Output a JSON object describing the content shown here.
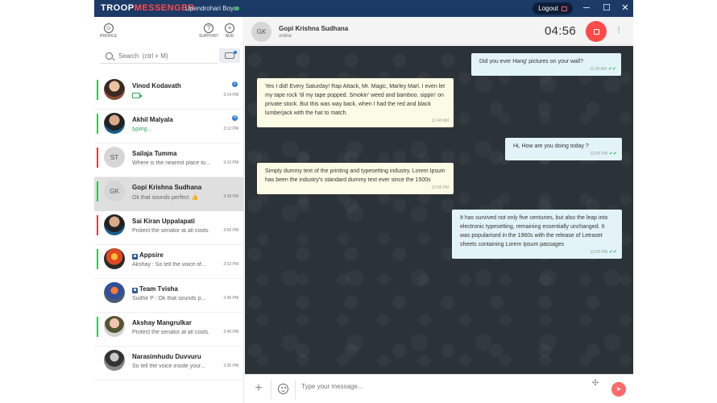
{
  "titlebar": {
    "brand_part1": "TROOP",
    "brand_part2": "MESSENGER",
    "username": "Upendrohari Boyo",
    "logout_label": "Logout",
    "minimize": "─",
    "maximize": "☐",
    "close": "✕"
  },
  "toolbar": {
    "profile_label": "PROFILE",
    "support_label": "SUPPORT",
    "add_label": "ADD"
  },
  "search": {
    "placeholder": "Search  (ctrl + M)"
  },
  "contacts": [
    {
      "name": "Vinod Kodavath",
      "message": "",
      "time": "3:14 PM",
      "badge": "2",
      "bar": "#33c14f",
      "avatar": "photo",
      "initials": ""
    },
    {
      "name": "Akhil Malyala",
      "message": "typing...",
      "time": "3:12 PM",
      "badge": "4",
      "bar": "#33c14f",
      "avatar": "photo2",
      "initials": ""
    },
    {
      "name": "Sailaja Tumma",
      "message": "Where is the nearest place to...",
      "time": "3:10 PM",
      "badge": "",
      "bar": "#e43b3b",
      "avatar": "init",
      "initials": "ST"
    },
    {
      "name": "Gopi Krishna Sudhana",
      "message": "Ok that sounds perfect",
      "time": "3:39 PM",
      "badge": "",
      "bar": "#33c14f",
      "avatar": "init",
      "initials": "GK"
    },
    {
      "name": "Sai Kiran Uppalapati",
      "message": "Protect the senator at all costs.",
      "time": "3:00 PM",
      "badge": "",
      "bar": "#e43b3b",
      "avatar": "photo2",
      "initials": ""
    },
    {
      "name": "Appsire",
      "message": "Akshay  : So tell the voice of...",
      "time": "2:53 PM",
      "badge": "",
      "bar": "#33c14f",
      "avatar": "photo3",
      "initials": ""
    },
    {
      "name": "Team Tvisha",
      "message": "Sudhir P : Ok that sounds p...",
      "time": "2:45 PM",
      "badge": "",
      "bar": "",
      "avatar": "photo4",
      "initials": ""
    },
    {
      "name": "Akshay Mangrulkar",
      "message": "Protect the senator at all costs.",
      "time": "2:40 PM",
      "badge": "",
      "bar": "#33c14f",
      "avatar": "photo5",
      "initials": ""
    },
    {
      "name": "Narasimhudu Duvvuru",
      "message": "So tell the voice inside your...",
      "time": "2:35 PM",
      "badge": "",
      "bar": "",
      "avatar": "photo6",
      "initials": ""
    }
  ],
  "chat": {
    "initials": "GK",
    "name": "Gopi Krishna Sudhana",
    "status": "online",
    "timer": "04:56"
  },
  "messages": [
    {
      "direction": "out",
      "text": "Did you ever Hang' pictures on your wall?",
      "time": "11:39 AM"
    },
    {
      "direction": "in",
      "text": "Yes I did! Every Saturday! Rap Attack, Mr. Magic, Marley Marl. I even let my tape rock 'til my tape popped. Smokin' weed and bamboo, sippin' on private stock.  But this was way back, when I had the red and black lumberjack with the hat to match.",
      "time": "11:40 AM"
    },
    {
      "direction": "out",
      "text": "Hi, How are you doing today ?",
      "time": "12:05 PM"
    },
    {
      "direction": "in",
      "text": "Simply dummy text of the printing and typesetting industry. Lorem Ipsum has been the industry's standard dummy text ever since the 1500s",
      "time": "12:06 PM"
    },
    {
      "direction": "out",
      "text": "It has survived not only five centuries, but also the leap into electronic typesetting, remaining essentially unchanged. It was popularised in the 1960s with the release of Letraset sheets containing Lorem Ipsum passages",
      "time": "12:05 PM"
    }
  ],
  "composer": {
    "placeholder": "Type your message..."
  },
  "colors": {
    "titlebar": "#1c3a66",
    "accent_red": "#ff4a4a",
    "online_green": "#33c14f"
  }
}
